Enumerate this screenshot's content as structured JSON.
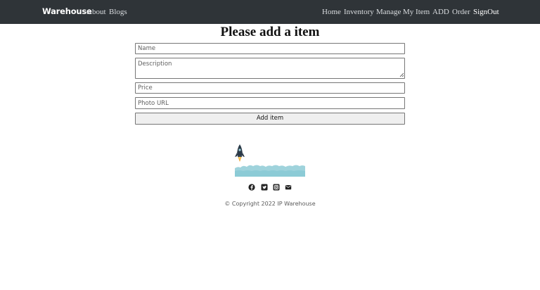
{
  "navbar": {
    "brand": "Warehouse",
    "left_links": [
      "About",
      "Blogs"
    ],
    "right_links": [
      "Home",
      "Inventory",
      "Manage",
      "My Item",
      "ADD",
      "Order",
      "SignOut"
    ],
    "background_color": "#2f3438"
  },
  "form": {
    "title": "Please add a item",
    "name_placeholder": "Name",
    "description_placeholder": "Description",
    "price_placeholder": "Price",
    "photo_placeholder": "Photo URL",
    "submit_label": "Add item"
  },
  "footer": {
    "social_icons": [
      "facebook-icon",
      "twitter-icon",
      "instagram-icon",
      "envelope-icon"
    ],
    "copyright": "© Copyright 2022 IP Warehouse"
  }
}
